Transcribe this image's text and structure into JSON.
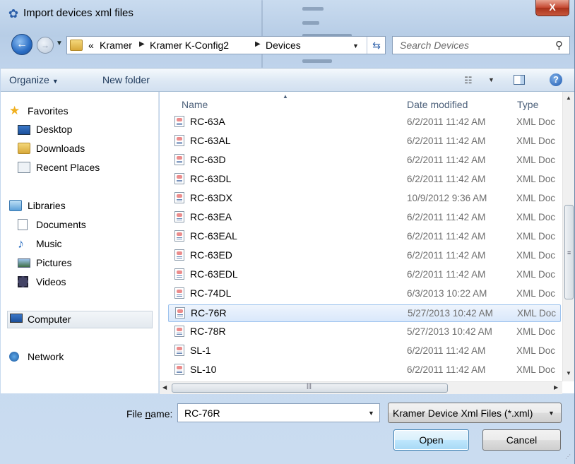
{
  "window": {
    "title": "Import devices xml files",
    "close_label": "X",
    "icon": "gear-icon"
  },
  "address": {
    "overflow": "«",
    "crumbs": [
      "Kramer",
      "Kramer K-Config2",
      "Devices"
    ],
    "search_placeholder": "Search Devices"
  },
  "toolbar": {
    "organize_label": "Organize",
    "new_folder_label": "New folder",
    "help_label": "?"
  },
  "nav": {
    "favorites_header": "Favorites",
    "favorites": [
      "Desktop",
      "Downloads",
      "Recent Places"
    ],
    "libraries_header": "Libraries",
    "libraries": [
      "Documents",
      "Music",
      "Pictures",
      "Videos"
    ],
    "computer": "Computer",
    "network": "Network"
  },
  "columns": {
    "name": "Name",
    "date": "Date modified",
    "type": "Type"
  },
  "files": [
    {
      "name": "RC-63A",
      "date": "6/2/2011 11:42 AM",
      "type": "XML Doc"
    },
    {
      "name": "RC-63AL",
      "date": "6/2/2011 11:42 AM",
      "type": "XML Doc"
    },
    {
      "name": "RC-63D",
      "date": "6/2/2011 11:42 AM",
      "type": "XML Doc"
    },
    {
      "name": "RC-63DL",
      "date": "6/2/2011 11:42 AM",
      "type": "XML Doc"
    },
    {
      "name": "RC-63DX",
      "date": "10/9/2012 9:36 AM",
      "type": "XML Doc"
    },
    {
      "name": "RC-63EA",
      "date": "6/2/2011 11:42 AM",
      "type": "XML Doc"
    },
    {
      "name": "RC-63EAL",
      "date": "6/2/2011 11:42 AM",
      "type": "XML Doc"
    },
    {
      "name": "RC-63ED",
      "date": "6/2/2011 11:42 AM",
      "type": "XML Doc"
    },
    {
      "name": "RC-63EDL",
      "date": "6/2/2011 11:42 AM",
      "type": "XML Doc"
    },
    {
      "name": "RC-74DL",
      "date": "6/3/2013 10:22 AM",
      "type": "XML Doc"
    },
    {
      "name": "RC-76R",
      "date": "5/27/2013 10:42 AM",
      "type": "XML Doc",
      "selected": true
    },
    {
      "name": "RC-78R",
      "date": "5/27/2013 10:42 AM",
      "type": "XML Doc"
    },
    {
      "name": "SL-1",
      "date": "6/2/2011 11:42 AM",
      "type": "XML Doc"
    },
    {
      "name": "SL-10",
      "date": "6/2/2011 11:42 AM",
      "type": "XML Doc"
    }
  ],
  "footer": {
    "file_name_label_pre": "File ",
    "file_name_label_u": "n",
    "file_name_label_post": "ame:",
    "file_name_value": "RC-76R",
    "filter_value": "Kramer Device Xml Files (*.xml)",
    "open_label": "Open",
    "cancel_label": "Cancel"
  }
}
